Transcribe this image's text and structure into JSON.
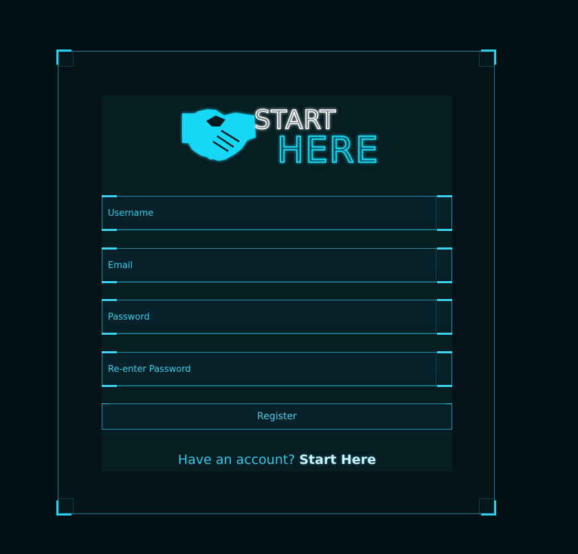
{
  "logo": {
    "line1": "START",
    "line2": "HERE",
    "icon": "handshake-icon"
  },
  "form": {
    "username_placeholder": "Username",
    "email_placeholder": "Email",
    "password_placeholder": "Password",
    "reenter_password_placeholder": "Re-enter Password",
    "register_label": "Register"
  },
  "footer": {
    "prompt": "Have an account? ",
    "link": "Start Here"
  },
  "colors": {
    "background": "#041114",
    "accent": "#2fd0ef",
    "panel": "#061d22",
    "text": "#39cde9"
  }
}
